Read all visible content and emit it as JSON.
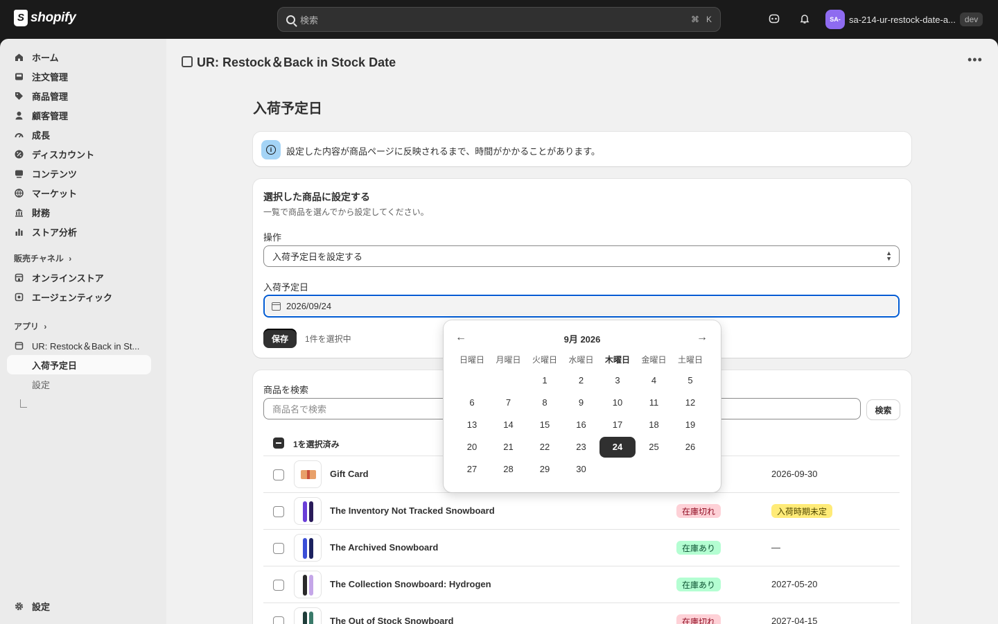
{
  "topbar": {
    "logo_text": "shopify",
    "search_placeholder": "検索",
    "shortcut_cmd": "⌘",
    "shortcut_key": "K",
    "store_initials": "SA-",
    "store_name": "sa-214-ur-restock-date-a...",
    "env_badge": "dev"
  },
  "sidebar": {
    "items": [
      {
        "label": "ホーム",
        "icon": "home-icon"
      },
      {
        "label": "注文管理",
        "icon": "inbox-icon"
      },
      {
        "label": "商品管理",
        "icon": "tag-icon"
      },
      {
        "label": "顧客管理",
        "icon": "person-icon"
      },
      {
        "label": "成長",
        "icon": "gauge-icon"
      },
      {
        "label": "ディスカウント",
        "icon": "discount-icon"
      },
      {
        "label": "コンテンツ",
        "icon": "content-icon"
      },
      {
        "label": "マーケット",
        "icon": "globe-icon"
      },
      {
        "label": "財務",
        "icon": "bank-icon"
      },
      {
        "label": "ストア分析",
        "icon": "chart-bar-icon"
      }
    ],
    "sales_channels_label": "販売チャネル",
    "channels": [
      {
        "label": "オンラインストア"
      },
      {
        "label": "エージェンティック"
      }
    ],
    "apps_label": "アプリ",
    "app_name": "UR: Restock＆Back in St...",
    "app_subitems": [
      {
        "label": "入荷予定日"
      },
      {
        "label": "設定"
      }
    ],
    "settings_label": "設定"
  },
  "main": {
    "app_title": "UR: Restock＆Back in Stock Date",
    "page_title": "入荷予定日",
    "banner_text": "設定した内容が商品ページに反映されるまで、時間がかかることがあります。",
    "bulk_card": {
      "title": "選択した商品に設定する",
      "subtitle": "一覧で商品を選んでから設定してください。",
      "operation_label": "操作",
      "operation_value": "入荷予定日を設定する",
      "date_label": "入荷予定日",
      "date_value": "2026/09/24",
      "save_label": "保存",
      "selected_count": "1件を選択中"
    },
    "products_card": {
      "search_label": "商品を検索",
      "search_placeholder": "商品名で検索",
      "search_button": "検索",
      "selected_text": "1を選択済み",
      "rows": [
        {
          "name": "Gift Card",
          "status": "",
          "date": "2026-09-30"
        },
        {
          "name": "The Inventory Not Tracked Snowboard",
          "status": "在庫切れ",
          "date": "入荷時期未定"
        },
        {
          "name": "The Archived Snowboard",
          "status": "在庫あり",
          "date": "—"
        },
        {
          "name": "The Collection Snowboard: Hydrogen",
          "status": "在庫あり",
          "date": "2027-05-20"
        },
        {
          "name": "The Out of Stock Snowboard",
          "status": "在庫切れ",
          "date": "2027-04-15"
        }
      ]
    }
  },
  "calendar": {
    "month_label": "9月 2026",
    "weekdays": [
      "日曜日",
      "月曜日",
      "火曜日",
      "水曜日",
      "木曜日",
      "金曜日",
      "土曜日"
    ],
    "days": [
      1,
      2,
      3,
      4,
      5,
      6,
      7,
      8,
      9,
      10,
      11,
      12,
      13,
      14,
      15,
      16,
      17,
      18,
      19,
      20,
      21,
      22,
      23,
      24,
      25,
      26,
      27,
      28,
      29,
      30
    ],
    "selected_day": 24,
    "prev_label": "←",
    "next_label": "→"
  },
  "colors": {
    "accent_focus": "#005bd3",
    "status_out": "#fed1d7",
    "status_in": "#b4fed2",
    "status_pending": "#ffeb78"
  }
}
